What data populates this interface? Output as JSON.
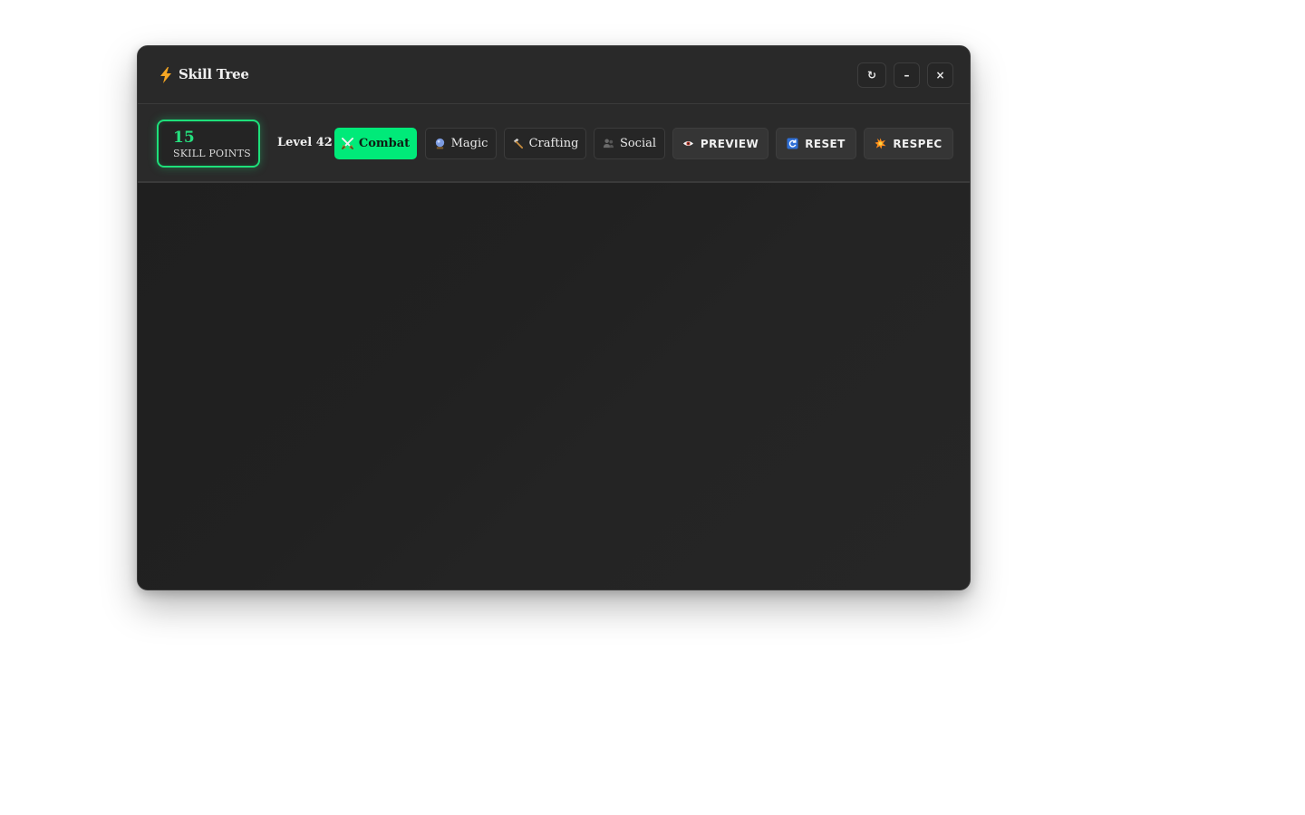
{
  "window": {
    "title": "Skill Tree",
    "title_icon": "lightning-icon",
    "controls": {
      "refresh": "↻",
      "minimize": "–",
      "close": "×"
    }
  },
  "toolbar": {
    "skill_points": {
      "value": "15",
      "label": "SKILL POINTS"
    },
    "level": "Level 42",
    "tabs": [
      {
        "label": "Combat",
        "icon": "crossed-swords-icon",
        "active": true
      },
      {
        "label": "Magic",
        "icon": "crystal-ball-icon",
        "active": false
      },
      {
        "label": "Crafting",
        "icon": "hammer-icon",
        "active": false
      },
      {
        "label": "Social",
        "icon": "people-icon",
        "active": false
      }
    ],
    "actions": [
      {
        "label": "PREVIEW",
        "icon": "eye-icon"
      },
      {
        "label": "RESET",
        "icon": "refresh-icon"
      },
      {
        "label": "RESPEC",
        "icon": "explosion-icon"
      }
    ]
  },
  "colors": {
    "accent": "#00ea79",
    "window_bg": "#232323",
    "toolbar_bg": "#2a2a2a"
  }
}
